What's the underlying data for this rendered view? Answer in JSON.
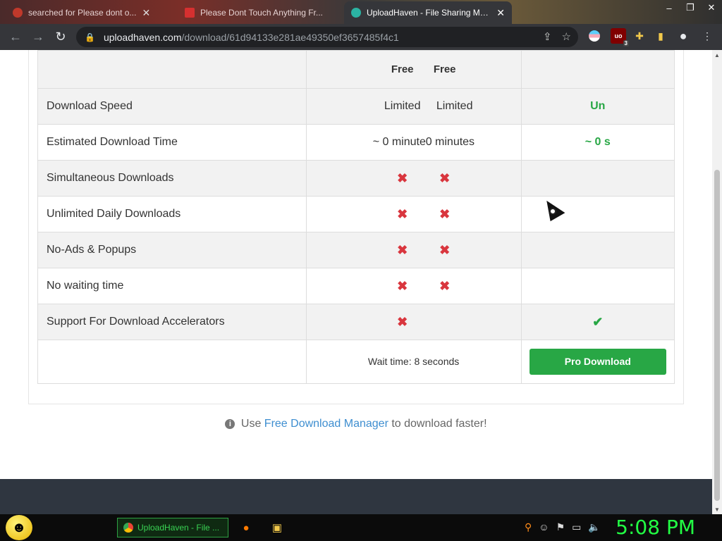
{
  "browser": {
    "tabs": [
      {
        "title": "searched for Please dont o...",
        "active": false
      },
      {
        "title": "Please Dont Touch Anything Fr...",
        "active": false
      },
      {
        "title": "UploadHaven - File Sharing Mad...",
        "active": true
      }
    ],
    "url_host": "uploadhaven.com",
    "url_path": "/download/61d94133e281ae49350ef3657485f4c1",
    "ublock_count": "3",
    "icons": [
      "back-icon",
      "forward-icon",
      "reload-icon",
      "lock-icon",
      "share-icon",
      "star-icon",
      "extensions-icon",
      "sidebar-icon",
      "profile-icon",
      "menu-icon"
    ]
  },
  "comparison": {
    "header": {
      "free_a": "Free",
      "free_b": "Free",
      "pro": ""
    },
    "rows": [
      {
        "feature": "Download Speed",
        "free_a": "Limited",
        "free_b": "Limited",
        "pro": "Un"
      },
      {
        "feature": "Estimated Download Time",
        "free_a": "~ 0 minute",
        "free_b": "0 minutes",
        "pro": "~ 0 s"
      },
      {
        "feature": "Simultaneous Downloads",
        "free_a": "✖",
        "free_b": "✖",
        "pro": ""
      },
      {
        "feature": "Unlimited Daily Downloads",
        "free_a": "✖",
        "free_b": "✖",
        "pro": ""
      },
      {
        "feature": "No-Ads & Popups",
        "free_a": "✖",
        "free_b": "✖",
        "pro": ""
      },
      {
        "feature": "No waiting time",
        "free_a": "✖",
        "free_b": "✖",
        "pro": ""
      },
      {
        "feature": "Support For Download Accelerators",
        "free_a": "✖",
        "pro": "✔"
      }
    ],
    "wait_text": "Wait time: 8 seconds",
    "pro_button": "Pro Download"
  },
  "hint": {
    "prefix": "Use",
    "link": "Free Download Manager",
    "suffix": "to download faster!"
  },
  "taskbar": {
    "task_title": "UploadHaven - File ...",
    "clock": "5:08 PM"
  },
  "colors": {
    "accent_green": "#28a745",
    "cross_red": "#d9363e",
    "link_blue": "#3e8ed0",
    "clock_green": "#22ff44"
  }
}
